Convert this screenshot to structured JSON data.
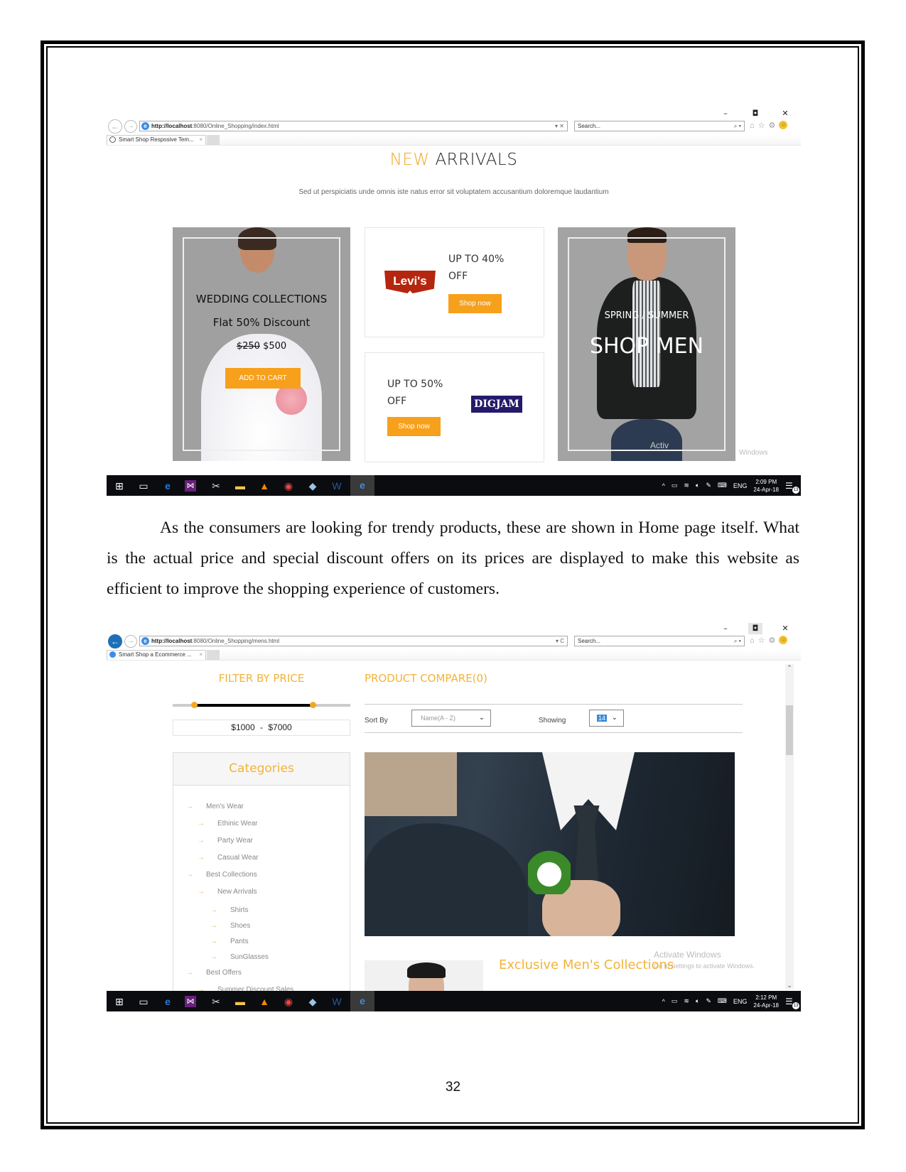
{
  "page_number": "32",
  "paragraph": "As the consumers are looking for trendy products, these are shown in Home page itself. What is the actual price and special discount offers on its prices are displayed to make this website as efficient to improve the shopping experience of customers.",
  "window_controls": {
    "minimize": "–",
    "restore": "◘",
    "close": "✕"
  },
  "screenshot1": {
    "browser": {
      "url_host": "http://localhost",
      "url_path": ":8080/Online_Shopping/index.html",
      "addr_tail": "▾ ✕",
      "search_placeholder": "Search...",
      "search_icon": "⌕ ▾",
      "tab_title": "Smart Shop Resposive Tem...",
      "tab_close": "×"
    },
    "section_title_highlight": "NEW",
    "section_title_rest": "ARRIVALS",
    "section_subtitle": "Sed ut perspiciatis unde omnis iste natus error sit voluptatem accusantium doloremque laudantium",
    "wedding_card": {
      "title": "WEDDING COLLECTIONS",
      "discount": "Flat 50% Discount",
      "old_price": "$250",
      "new_price": "$500",
      "button": "ADD TO CART"
    },
    "promo_levis": {
      "brand": "Levi's",
      "line1": "UP TO 40%",
      "line2": "OFF",
      "button": "Shop now"
    },
    "promo_digjam": {
      "brand": "DIGJAM",
      "line1": "UP TO 50%",
      "line2": "OFF",
      "button": "Shop now"
    },
    "men_card": {
      "subtitle": "SPRING / SUMMER",
      "title": "SHOP MEN"
    },
    "watermark": {
      "line1": "Activ",
      "line2": "Windows"
    },
    "taskbar": {
      "time": "2:09 PM",
      "date": "24-Apr-18",
      "lang": "ENG",
      "notifications": "13"
    }
  },
  "screenshot2": {
    "browser": {
      "url_host": "http://localhost",
      "url_path": ":8080/Online_Shopping/mens.html",
      "addr_tail": "▾ C",
      "search_placeholder": "Search...",
      "search_icon": "⌕ ▾",
      "tab_title": "Smart Shop a Ecommerce ...",
      "tab_close": "×"
    },
    "filter_title": "FILTER BY PRICE",
    "price_min": "$1000",
    "price_sep": "-",
    "price_max": "$7000",
    "compare_title": "PRODUCT COMPARE(0)",
    "sort_label": "Sort By",
    "sort_value": "Name(A - Z)",
    "showing_label": "Showing",
    "showing_value": "14",
    "categories_title": "Categories",
    "categories": [
      {
        "label": "Men's Wear",
        "level": 0
      },
      {
        "label": "Ethinic Wear",
        "level": 1
      },
      {
        "label": "Party Wear",
        "level": 1
      },
      {
        "label": "Casual Wear",
        "level": 1
      },
      {
        "label": "Best Collections",
        "level": 0
      },
      {
        "label": "New Arrivals",
        "level": 1
      },
      {
        "label": "Shirts",
        "level": 2
      },
      {
        "label": "Shoes",
        "level": 2
      },
      {
        "label": "Pants",
        "level": 2
      },
      {
        "label": "SunGlasses",
        "level": 2
      },
      {
        "label": "Best Offers",
        "level": 0
      },
      {
        "label": "Summer Discount Sales",
        "level": 1
      }
    ],
    "exclusive_title": "Exclusive Men's Collections",
    "activate_windows": "Activate Windows",
    "activate_windows_sub": "Go to Settings to activate Windows.",
    "taskbar": {
      "time": "2:12 PM",
      "date": "24-Apr-18",
      "lang": "ENG",
      "notifications": "13"
    }
  },
  "taskbar_icons": [
    "windows-start",
    "task-view",
    "edge",
    "visual-studio",
    "tools",
    "file-explorer",
    "vlc",
    "chrome",
    "virtualbox",
    "word",
    "internet-explorer"
  ]
}
